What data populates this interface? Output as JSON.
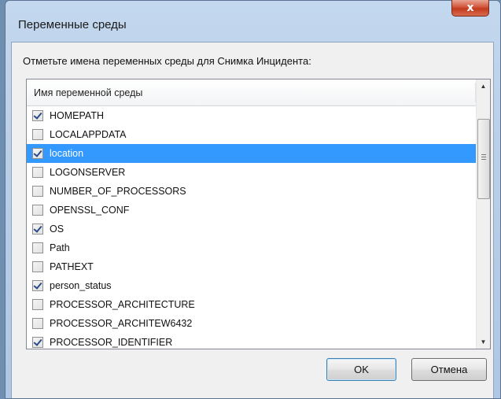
{
  "window": {
    "title": "Переменные среды",
    "close_label": "x"
  },
  "prompt": "Отметьте имена переменных среды для Снимка Инцидента:",
  "list": {
    "column_header": "Имя переменной среды",
    "items": [
      {
        "label": "HOMEPATH",
        "checked": true,
        "selected": false
      },
      {
        "label": "LOCALAPPDATA",
        "checked": false,
        "selected": false
      },
      {
        "label": "location",
        "checked": true,
        "selected": true
      },
      {
        "label": "LOGONSERVER",
        "checked": false,
        "selected": false
      },
      {
        "label": "NUMBER_OF_PROCESSORS",
        "checked": false,
        "selected": false
      },
      {
        "label": "OPENSSL_CONF",
        "checked": false,
        "selected": false
      },
      {
        "label": "OS",
        "checked": true,
        "selected": false
      },
      {
        "label": "Path",
        "checked": false,
        "selected": false
      },
      {
        "label": "PATHEXT",
        "checked": false,
        "selected": false
      },
      {
        "label": "person_status",
        "checked": true,
        "selected": false
      },
      {
        "label": "PROCESSOR_ARCHITECTURE",
        "checked": false,
        "selected": false
      },
      {
        "label": "PROCESSOR_ARCHITEW6432",
        "checked": false,
        "selected": false
      },
      {
        "label": "PROCESSOR_IDENTIFIER",
        "checked": true,
        "selected": false
      }
    ]
  },
  "buttons": {
    "ok_label": "OK",
    "cancel_label": "Отмена"
  },
  "colors": {
    "selection": "#3399ff",
    "close_button": "#c9452a",
    "checkmark": "#2a4b8a"
  }
}
